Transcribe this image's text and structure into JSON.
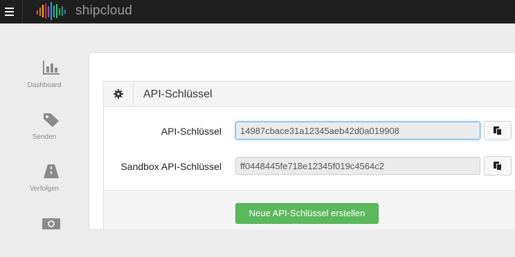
{
  "brand": {
    "name": "shipcloud"
  },
  "sidebar": {
    "items": [
      {
        "label": "Dashboard",
        "icon": "bar-chart-icon"
      },
      {
        "label": "Senden",
        "icon": "tags-icon"
      },
      {
        "label": "Verfolgen",
        "icon": "road-icon"
      },
      {
        "label": "",
        "icon": "money-icon"
      }
    ]
  },
  "panel": {
    "icon": "gear-icon",
    "title": "API-Schlüssel",
    "fields": [
      {
        "label": "API-Schlüssel",
        "value": "14987cbace31a12345aeb42d0a019908"
      },
      {
        "label": "Sandbox API-Schlüssel",
        "value": "ff0448445fe718e12345f019c4564c2"
      }
    ],
    "create_button": "Neue API-Schlüssel erstellen"
  },
  "colors": {
    "topbar": "#1f1f1f",
    "accent_green": "#5cb85c",
    "focus_blue": "#66afe9"
  }
}
